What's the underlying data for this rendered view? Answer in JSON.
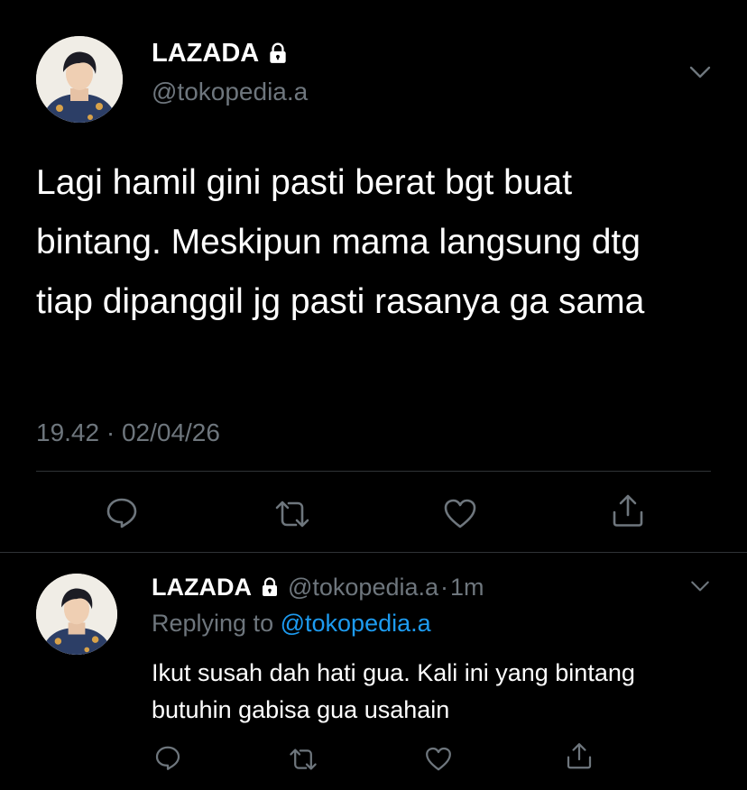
{
  "main_tweet": {
    "display_name": "LAZADA",
    "handle": "@tokopedia.a",
    "text": "Lagi hamil gini pasti berat bgt buat bintang. Meskipun mama langsung dtg tiap dipanggil jg pasti rasanya ga sama",
    "timestamp": "19.42 · 02/04/26"
  },
  "reply_tweet": {
    "display_name": "LAZADA",
    "handle": "@tokopedia.a",
    "separator": "·",
    "time_ago": "1m",
    "replying_prefix": "Replying to",
    "replying_to": "@tokopedia.a",
    "text": "Ikut susah dah hati gua. Kali ini yang bintang butuhin gabisa gua usahain"
  },
  "icons": {
    "lock": "lock-icon",
    "chevron": "chevron-down-icon",
    "reply": "reply-icon",
    "retweet": "retweet-icon",
    "like": "heart-icon",
    "share": "share-icon"
  },
  "colors": {
    "background": "#000000",
    "text": "#ffffff",
    "muted": "#6e767d",
    "link": "#1d9bf0",
    "divider": "#2f3336"
  }
}
